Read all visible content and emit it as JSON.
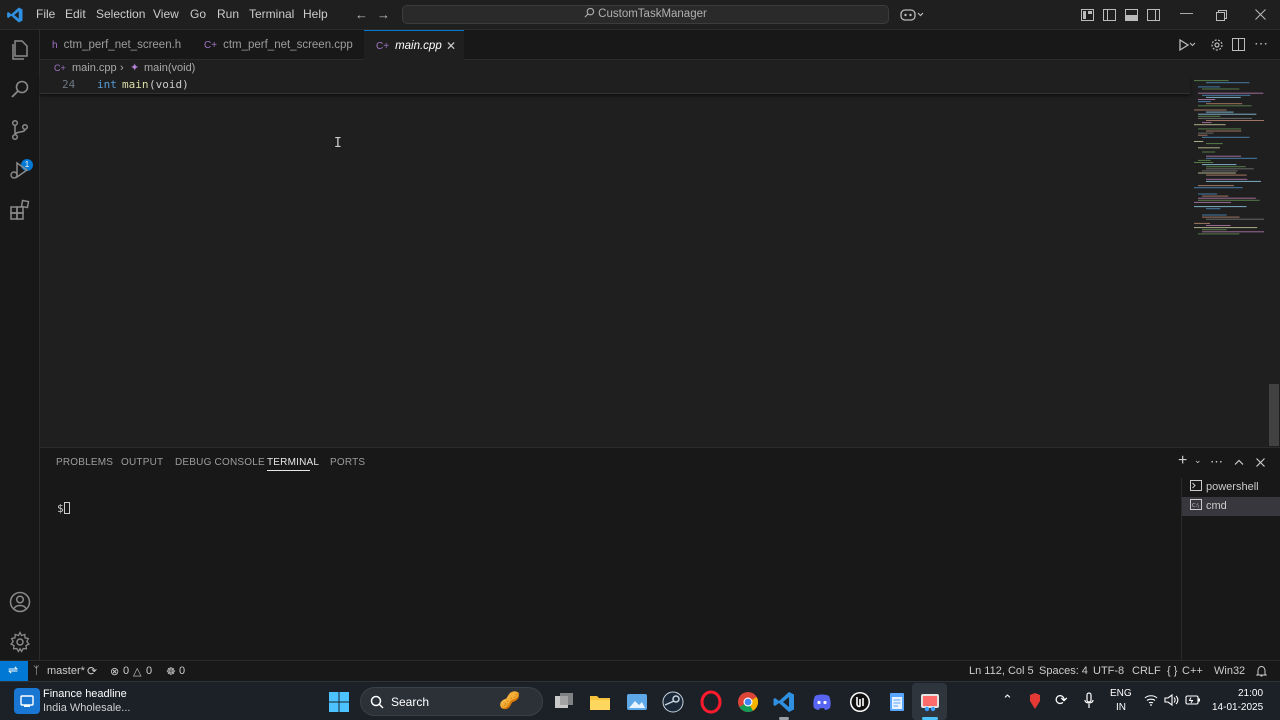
{
  "titlebar": {
    "menu": [
      "File",
      "Edit",
      "Selection",
      "View",
      "Go",
      "Run",
      "Terminal",
      "Help"
    ],
    "search_text": "CustomTaskManager"
  },
  "activity": {
    "source_control_badge": "1"
  },
  "tabs": [
    {
      "label": "ctm_perf_net_screen.h",
      "icon": "h"
    },
    {
      "label": "ctm_perf_net_screen.cpp",
      "icon": "C+"
    },
    {
      "label": "main.cpp",
      "icon": "C+"
    }
  ],
  "breadcrumb": {
    "file": "main.cpp",
    "symbol": "main(void)"
  },
  "sticky": {
    "line_number": "24",
    "keyword": "int",
    "function": "main",
    "params": "(void)"
  },
  "panel": {
    "tabs": [
      "PROBLEMS",
      "OUTPUT",
      "DEBUG CONSOLE",
      "TERMINAL",
      "PORTS"
    ],
    "active_tab": "TERMINAL",
    "prompt": "$",
    "terminals": [
      "powershell",
      "cmd"
    ]
  },
  "statusbar": {
    "branch": "master*",
    "errors": "0",
    "warnings": "0",
    "ports": "0",
    "position": "Ln 112, Col 5",
    "spaces": "Spaces: 4",
    "encoding": "UTF-8",
    "eol": "CRLF",
    "language": "C++",
    "platform": "Win32"
  },
  "taskbar": {
    "widget_title": "Finance headline",
    "widget_subtitle": "India Wholesale...",
    "search_label": "Search",
    "lang_top": "ENG",
    "lang_bottom": "IN",
    "time": "21:00",
    "date": "14-01-2025"
  },
  "colors": {
    "accent": "#0078d4",
    "remote": "#0078d4",
    "keyword": "#569cd6",
    "function": "#dcdcaa"
  }
}
